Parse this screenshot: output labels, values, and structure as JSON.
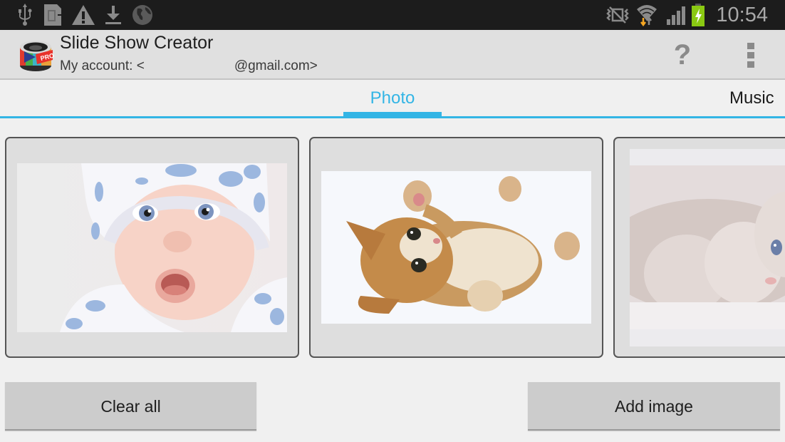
{
  "status_bar": {
    "time": "10:54",
    "left_icons": [
      "usb-icon",
      "sd-card-icon",
      "warning-icon",
      "download-icon",
      "globe-icon"
    ],
    "right_icons": [
      "vibrate-mute-icon",
      "wifi-icon",
      "signal-icon",
      "battery-charging-icon"
    ],
    "colors": {
      "background": "#1c1c1c",
      "icon": "#8a8a8a",
      "battery": "#8ac912",
      "wifi_down_arrow": "#f5a623"
    }
  },
  "action_bar": {
    "title": "Slide Show Creator",
    "account_label": "My account: <",
    "account_email_suffix": "@gmail.com>",
    "help_label": "?",
    "app_badge": "PRO"
  },
  "tabs": [
    {
      "label": "Photo",
      "active": true
    },
    {
      "label": "Music",
      "active": false
    }
  ],
  "accent_color": "#33b5e5",
  "photos": [
    {
      "subject": "baby-in-cloud-hat"
    },
    {
      "subject": "ginger-kitten-rolling"
    },
    {
      "subject": "white-kitten-lying"
    }
  ],
  "buttons": {
    "clear_all": "Clear all",
    "add_image": "Add image"
  }
}
